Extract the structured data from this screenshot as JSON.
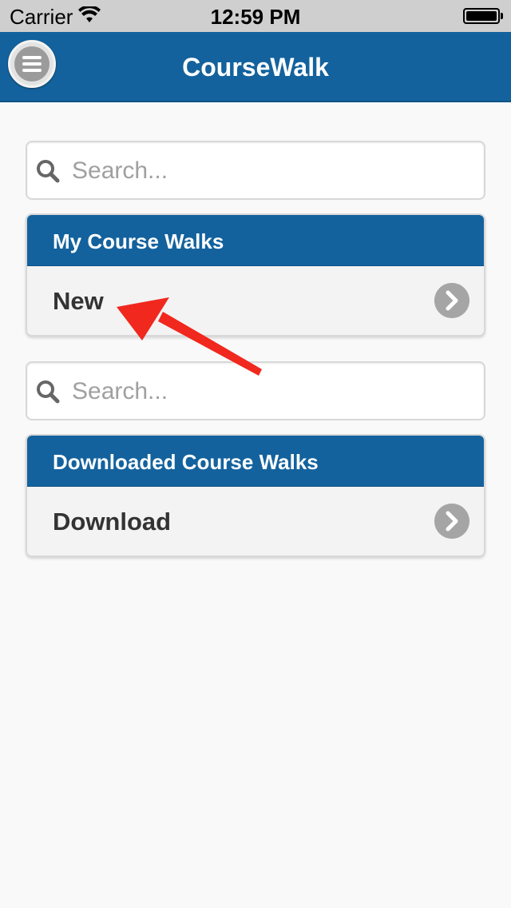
{
  "status_bar": {
    "carrier": "Carrier",
    "time": "12:59 PM"
  },
  "nav": {
    "title": "CourseWalk",
    "menu_icon": "hamburger-menu-icon"
  },
  "search_top": {
    "placeholder": "Search..."
  },
  "my_walks": {
    "header": "My Course Walks",
    "items": [
      {
        "label": "New"
      }
    ]
  },
  "search_bottom": {
    "placeholder": "Search..."
  },
  "downloaded_walks": {
    "header": "Downloaded Course Walks",
    "items": [
      {
        "label": "Download"
      }
    ]
  },
  "colors": {
    "nav_bg": "#13629d",
    "annotation_arrow": "#f0281e"
  }
}
